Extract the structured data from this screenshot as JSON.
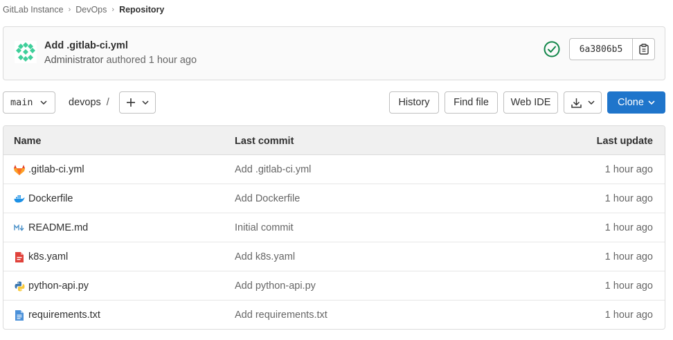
{
  "breadcrumb": {
    "items": [
      "GitLab Instance",
      "DevOps"
    ],
    "current": "Repository"
  },
  "commit": {
    "title": "Add .gitlab-ci.yml",
    "author": "Administrator",
    "meta_suffix": "authored 1 hour ago",
    "status": "passed",
    "sha": "6a3806b5",
    "colors": {
      "status": "#108548"
    }
  },
  "toolbar": {
    "branch": "main",
    "path": "devops",
    "path_sep": "/",
    "history_label": "History",
    "find_file_label": "Find file",
    "web_ide_label": "Web IDE",
    "clone_label": "Clone",
    "colors": {
      "primary": "#1f75cb"
    }
  },
  "table": {
    "headers": {
      "name": "Name",
      "last_commit": "Last commit",
      "last_update": "Last update"
    },
    "rows": [
      {
        "name": ".gitlab-ci.yml",
        "icon": "gitlab-icon",
        "commit": "Add .gitlab-ci.yml",
        "updated": "1 hour ago"
      },
      {
        "name": "Dockerfile",
        "icon": "docker-icon",
        "commit": "Add Dockerfile",
        "updated": "1 hour ago"
      },
      {
        "name": "README.md",
        "icon": "markdown-icon",
        "commit": "Initial commit",
        "updated": "1 hour ago"
      },
      {
        "name": "k8s.yaml",
        "icon": "yaml-file-icon",
        "commit": "Add k8s.yaml",
        "updated": "1 hour ago"
      },
      {
        "name": "python-api.py",
        "icon": "python-icon",
        "commit": "Add python-api.py",
        "updated": "1 hour ago"
      },
      {
        "name": "requirements.txt",
        "icon": "text-file-icon",
        "commit": "Add requirements.txt",
        "updated": "1 hour ago"
      }
    ]
  }
}
